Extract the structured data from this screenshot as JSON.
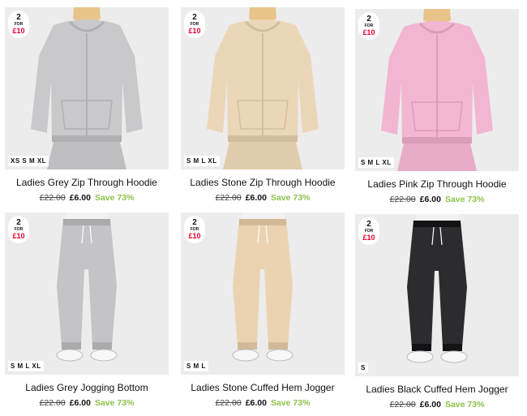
{
  "products": [
    {
      "title": "Ladies Grey Zip Through Hoodie",
      "was": "£22.00",
      "now": "£6.00",
      "save": "Save 73%",
      "sizes": "XS S M XL",
      "badge": {
        "n": "2",
        "for": "FOR",
        "price": "£10"
      },
      "color": "#c9c9cb",
      "kind": "hoodie"
    },
    {
      "title": "Ladies Stone Zip Through Hoodie",
      "was": "£22.00",
      "now": "£6.00",
      "save": "Save 73%",
      "sizes": "S M L XL",
      "badge": {
        "n": "2",
        "for": "FOR",
        "price": "£10"
      },
      "color": "#ecd6b8",
      "kind": "hoodie"
    },
    {
      "title": "Ladies Pink Zip Through Hoodie",
      "was": "£22.00",
      "now": "£6.00",
      "save": "Save 73%",
      "sizes": "S M L XL",
      "badge": {
        "n": "2",
        "for": "FOR",
        "price": "£10"
      },
      "color": "#f2b5d2",
      "kind": "hoodie"
    },
    {
      "title": "Ladies Grey Jogging Bottom",
      "was": "£22.00",
      "now": "£6.00",
      "save": "Save 73%",
      "sizes": "S M L XL",
      "badge": {
        "n": "2",
        "for": "FOR",
        "price": "£10"
      },
      "color": "#c4c4c6",
      "kind": "jogger"
    },
    {
      "title": "Ladies Stone Cuffed Hem Jogger",
      "was": "£22.00",
      "now": "£6.00",
      "save": "Save 73%",
      "sizes": "S M L",
      "badge": {
        "n": "2",
        "for": "FOR",
        "price": "£10"
      },
      "color": "#ebd3b2",
      "kind": "jogger"
    },
    {
      "title": "Ladies Black Cuffed Hem Jogger",
      "was": "£22.00",
      "now": "£6.00",
      "save": "Save 73%",
      "sizes": "S",
      "badge": {
        "n": "2",
        "for": "FOR",
        "price": "£10"
      },
      "color": "#2c2c2e",
      "kind": "jogger"
    }
  ]
}
